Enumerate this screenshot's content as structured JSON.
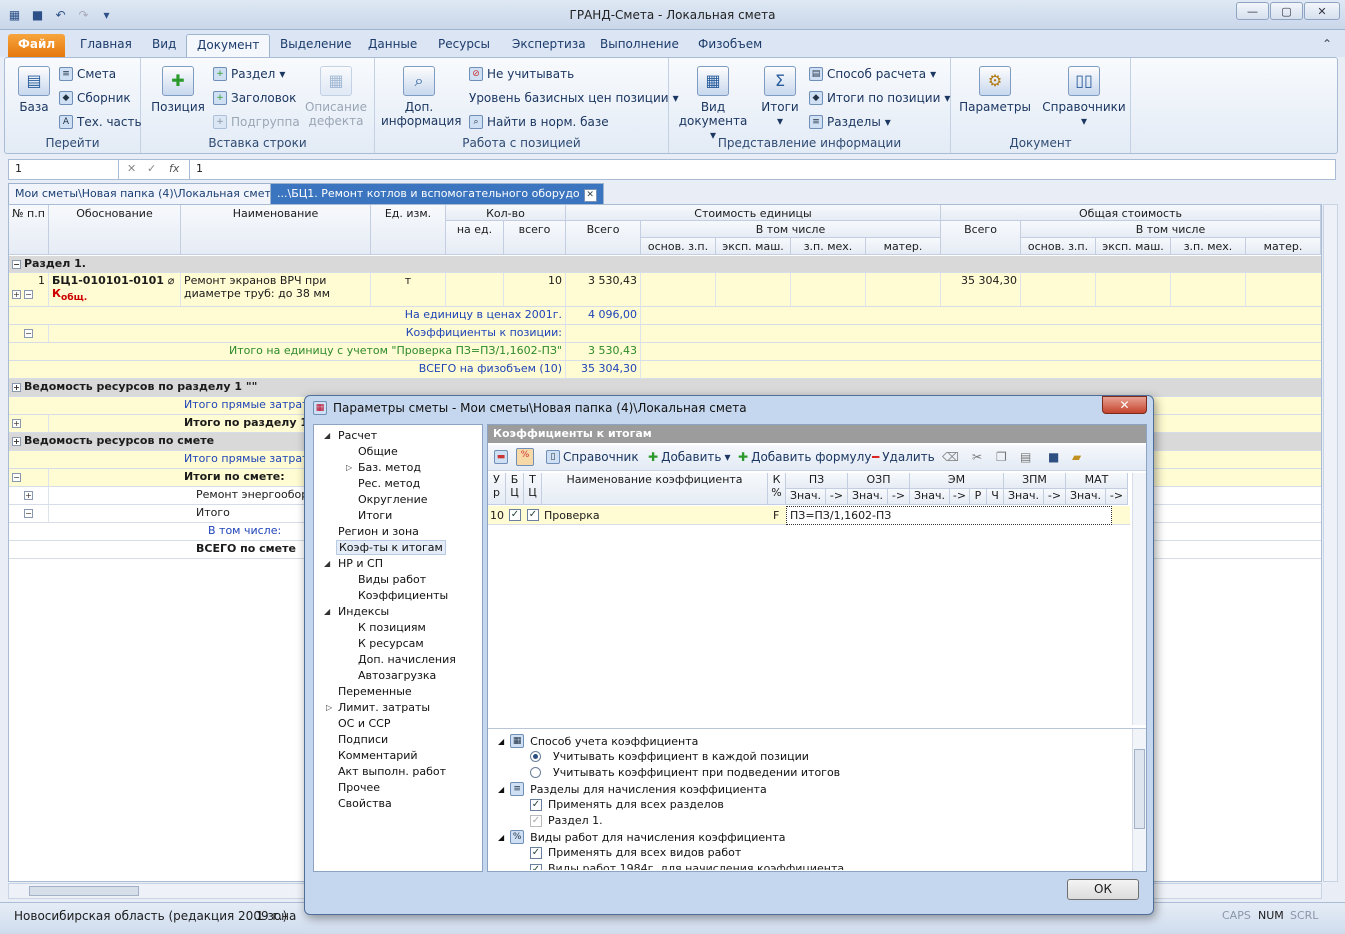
{
  "window": {
    "title": "ГРАНД-Смета - Локальная смета"
  },
  "tabs": [
    "Файл",
    "Главная",
    "Вид",
    "Документ",
    "Выделение",
    "Данные",
    "Ресурсы",
    "Экспертиза",
    "Выполнение",
    "Физобъем"
  ],
  "ribbon": {
    "goto": {
      "label": "Перейти",
      "base": "База",
      "items": [
        "Смета",
        "Сборник",
        "Тех. часть"
      ]
    },
    "insert": {
      "label": "Вставка строки",
      "position": "Позиция",
      "items": [
        "Раздел",
        "Заголовок",
        "Подгруппа"
      ],
      "defect": "Описание дефекта"
    },
    "work": {
      "label": "Работа с позицией",
      "info": "Доп. информация",
      "items": [
        "Не учитывать",
        "Уровень базисных цен позиции",
        "Найти в норм. базе"
      ]
    },
    "present": {
      "label": "Представление информации",
      "view": "Вид документа",
      "totals": "Итоги",
      "items": [
        "Способ расчета",
        "Итоги по позиции",
        "Разделы"
      ]
    },
    "doc": {
      "label": "Документ",
      "params": "Параметры",
      "refs": "Справочники"
    }
  },
  "formula_bar": {
    "cell": "1",
    "value": "1"
  },
  "doc_tabs": [
    "Мои сметы\\Новая папка (4)\\Локальная смета",
    "...\\БЦ1. Ремонт котлов и вспомогательного оборудо"
  ],
  "grid": {
    "headers": {
      "num": "№ п.п",
      "basis": "Обоснование",
      "name": "Наименование",
      "unit": "Ед. изм.",
      "qty": "Кол-во",
      "qty_unit": "на ед.",
      "qty_total": "всего",
      "unit_cost": "Стоимость единицы",
      "total": "Всего",
      "incl": "В том числе",
      "base_wage": "основ. з.п.",
      "mach": "эксп. маш.",
      "mech_wage": "з.п. мех.",
      "mater": "матер.",
      "total_cost": "Общая стоимость",
      "total2": "Всего",
      "incl2": "В том числе",
      "base_wage2": "основ. з.п.",
      "mach2": "эксп. маш.",
      "mech_wage2": "з.п. мех.",
      "mater2": "матер."
    },
    "section1": "Раздел 1.",
    "pos": {
      "num": "1",
      "code": "БЦ1-010101-0101",
      "k": "К",
      "k_sub": "общ.",
      "name": "Ремонт экранов ВРЧ при диаметре труб: до 38 мм",
      "unit": "т",
      "qty": "10",
      "price": "3 530,43",
      "total": "35 304,30"
    },
    "sub": [
      {
        "label": "На единицу в ценах 2001г.",
        "value": "4 096,00"
      },
      {
        "label": "Коэффициенты к позиции:",
        "value": ""
      },
      {
        "label": "Итого на единицу с учетом \"Проверка  ПЗ=ПЗ/1,1602-ПЗ\"",
        "value": "3 530,43"
      },
      {
        "label": "ВСЕГО на физобъем (10)",
        "value": "35 304,30"
      }
    ],
    "res_section": "Ведомость ресурсов по разделу 1 \"\"",
    "direct1": "Итого прямые затраты п",
    "total_section": "Итого по разделу 1",
    "res_estimate": "Ведомость ресурсов по смете",
    "direct2": "Итого прямые затраты п",
    "est_totals": "Итоги по смете:",
    "energy": "Ремонт энергооборуд",
    "itogo": "Итого",
    "incl_label": "В том числе:",
    "grand": "ВСЕГО по смете"
  },
  "status": {
    "region": "Новосибирская область (редакция 2009 г.)",
    "zone": "1 зона",
    "caps": "CAPS",
    "num": "NUM",
    "scrl": "SCRL"
  },
  "dialog": {
    "title": "Параметры сметы - Мои сметы\\Новая папка (4)\\Локальная смета",
    "tree": [
      "Расчет",
      "Общие",
      "Баз. метод",
      "Рес. метод",
      "Округление",
      "Итоги",
      "Регион и зона",
      "Коэф-ты к итогам",
      "НР и СП",
      "Виды работ",
      "Коэффициенты",
      "Индексы",
      "К позициям",
      "К ресурсам",
      "Доп. начисления",
      "Автозагрузка",
      "Переменные",
      "Лимит. затраты",
      "ОС и ССР",
      "Подписи",
      "Комментарий",
      "Акт выполн. работ",
      "Прочее",
      "Свойства"
    ],
    "panel_title": "Коэффициенты к итогам",
    "toolbar": {
      "ref": "Справочник",
      "add": "Добавить",
      "add_formula": "Добавить формулу",
      "delete": "Удалить"
    },
    "cols": {
      "u": "У",
      "r": "р",
      "b": "Б",
      "ts": "Ц",
      "t": "Т",
      "tc": "Ц",
      "name": "Наименование коэффициента",
      "k": "К",
      "pct": "%",
      "pz": "ПЗ",
      "ozp": "ОЗП",
      "em": "ЭМ",
      "zpm": "ЗПМ",
      "mat": "МАТ",
      "val": "Знач.",
      "arrow": "->",
      "p": "Р",
      "ch": "Ч"
    },
    "row": {
      "u": "10",
      "name": "Проверка",
      "k": "F",
      "formula": "ПЗ=ПЗ/1,1602-ПЗ"
    },
    "options": {
      "g1": "Способ учета коэффициента",
      "o1": "Учитывать коэффициент в каждой позиции",
      "o2": "Учитывать коэффициент при подведении итогов",
      "g2": "Разделы для начисления коэффициента",
      "o3": "Применять для всех разделов",
      "o4": "Раздел 1.",
      "g3": "Виды работ для начисления коэффициента",
      "o5": "Применять для всех видов работ",
      "o6": "Виды работ 1984г. для начисления коэффициента"
    },
    "ok": "ОК"
  }
}
